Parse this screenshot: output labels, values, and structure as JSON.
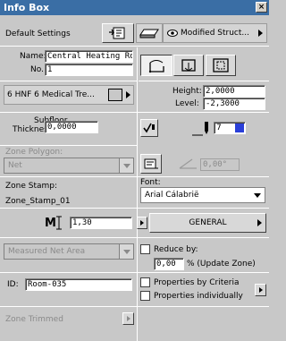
{
  "window": {
    "title": "Info Box",
    "close_glyph": "×"
  },
  "toolbar": {
    "default_settings_label": "Default Settings",
    "modified_structure_label": "Modified Struct..."
  },
  "name_section": {
    "name_label": "Name:",
    "name_value": "Central Heating Room",
    "no_label": "No.:",
    "no_value": "1"
  },
  "category": {
    "label": "6 HNF 6 Medical Tre..."
  },
  "dimensions": {
    "height_label": "Height:",
    "height_value": "2,0000",
    "level_label": "Level:",
    "level_value": "-2,3000"
  },
  "subfloor": {
    "label_line1": "Subfloor",
    "label_line2": "Thickness:",
    "value": "0,0000"
  },
  "pen": {
    "value": "7"
  },
  "zone_polygon": {
    "label": "Zone Polygon:",
    "value": "Net"
  },
  "angle": {
    "value": "0,00°"
  },
  "zone_stamp": {
    "label": "Zone Stamp:",
    "value": "Zone_Stamp_01"
  },
  "font": {
    "label": "Font:",
    "value": "Arial Cálabrië"
  },
  "scale": {
    "value": "1,30"
  },
  "general": {
    "label": "GENERAL"
  },
  "measured": {
    "value": "Measured Net Area"
  },
  "reduce": {
    "label": "Reduce by:",
    "value": "0,00",
    "unit_label": "% (Update Zone)"
  },
  "id": {
    "label": "ID:",
    "value": "Room-035"
  },
  "properties": {
    "by_criteria": "Properties by Criteria",
    "individually": "Properties individually"
  },
  "zone_trimmed": {
    "label": "Zone Trimmed"
  }
}
